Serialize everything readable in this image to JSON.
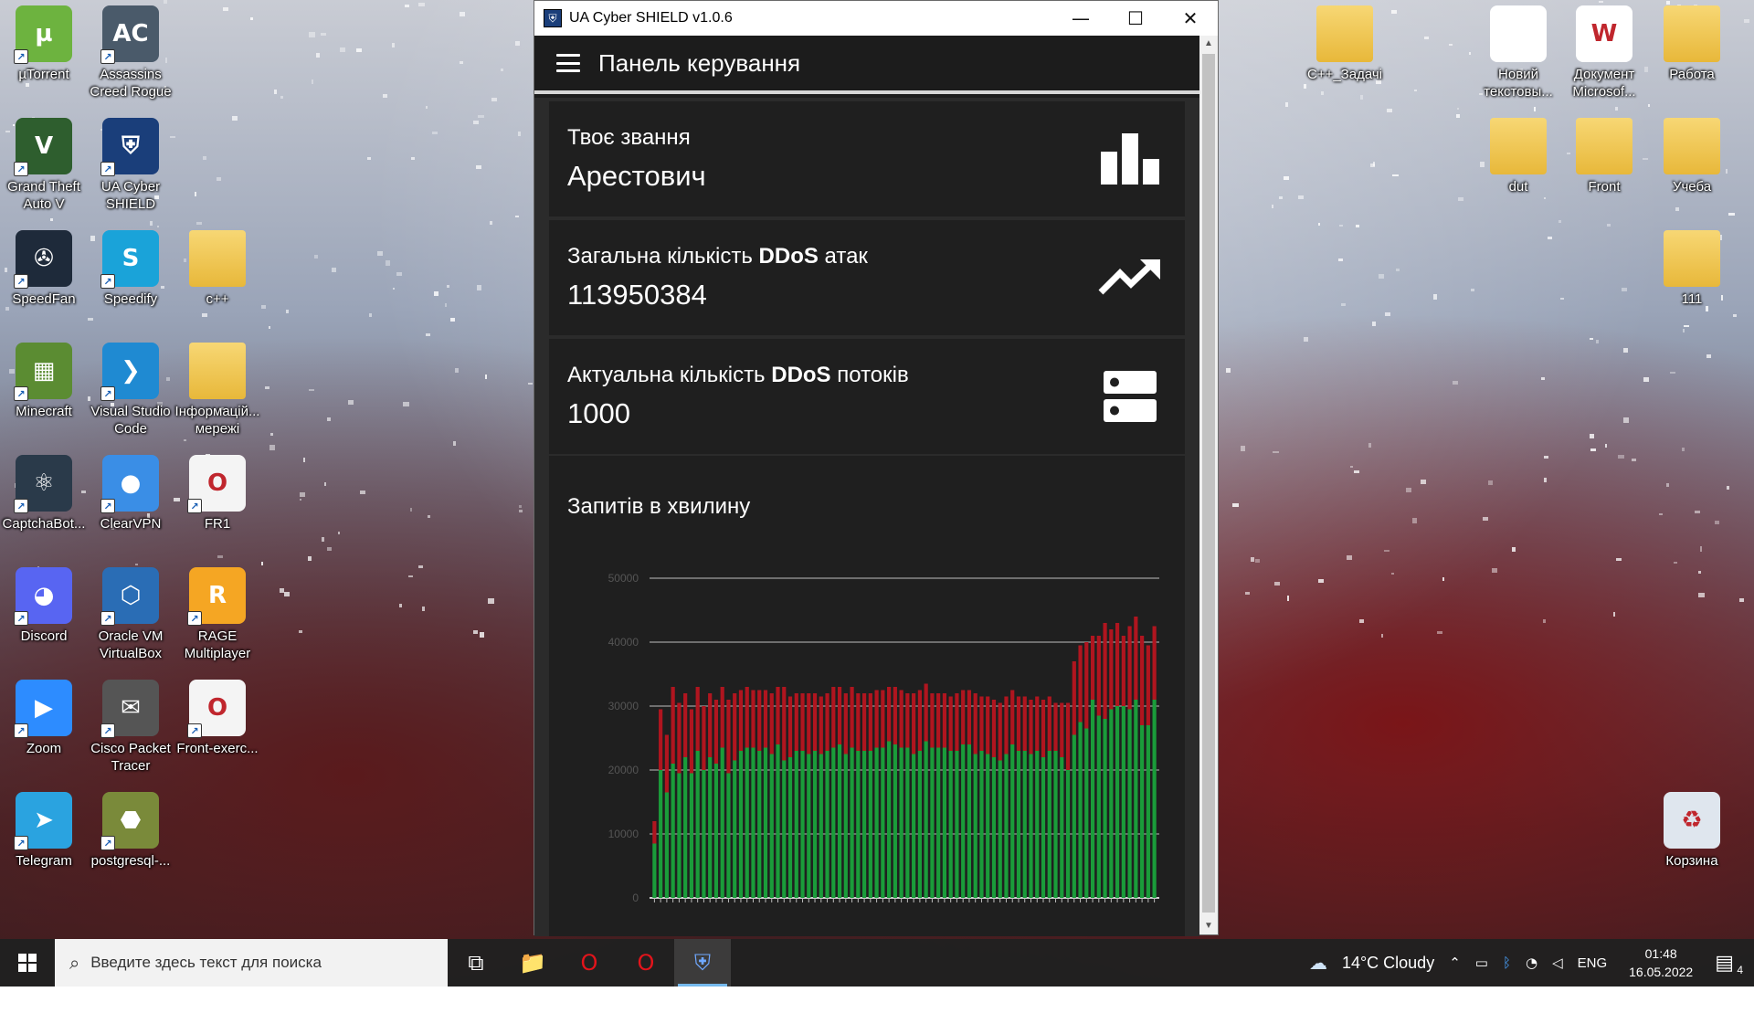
{
  "desktop": {
    "left_icons": [
      {
        "label": "µTorrent",
        "icon": "utorrent-icon",
        "color": "#6db33f",
        "glyph": "µ"
      },
      {
        "label": "Assassins Creed Rogue",
        "icon": "assassins-creed-icon",
        "color": "#4a5a6a",
        "glyph": "AC"
      },
      {
        "label": "Grand Theft Auto V",
        "icon": "gta-icon",
        "color": "#2e5e2e",
        "glyph": "V"
      },
      {
        "label": "UA Cyber SHIELD",
        "icon": "shield-icon",
        "color": "#1a3e7a",
        "glyph": "⛨"
      },
      {
        "label": "SpeedFan",
        "icon": "speedfan-icon",
        "color": "#1e2a3a",
        "glyph": "✇"
      },
      {
        "label": "Speedify",
        "icon": "speedify-icon",
        "color": "#1aa3d9",
        "glyph": "S"
      },
      {
        "label": "c++",
        "icon": "folder-icon",
        "color": "#e8b83a",
        "glyph": ""
      },
      {
        "label": "Minecraft",
        "icon": "minecraft-icon",
        "color": "#5b8c32",
        "glyph": "▦"
      },
      {
        "label": "Visual Studio Code",
        "icon": "vscode-icon",
        "color": "#1f8ad2",
        "glyph": "❯"
      },
      {
        "label": "Інформацій... мережі",
        "icon": "folder-icon",
        "color": "#e8b83a",
        "glyph": ""
      },
      {
        "label": "CaptchaBot...",
        "icon": "captchabot-icon",
        "color": "#2a3a4a",
        "glyph": "⚛"
      },
      {
        "label": "ClearVPN",
        "icon": "clearvpn-icon",
        "color": "#3a8ee6",
        "glyph": "●"
      },
      {
        "label": "FR1",
        "icon": "pdf-icon",
        "color": "#f4f4f4",
        "glyph": "O"
      },
      {
        "label": "Discord",
        "icon": "discord-icon",
        "color": "#5865f2",
        "glyph": "◕"
      },
      {
        "label": "Oracle VM VirtualBox",
        "icon": "virtualbox-icon",
        "color": "#2a6db5",
        "glyph": "⬡"
      },
      {
        "label": "RAGE Multiplayer",
        "icon": "rage-icon",
        "color": "#f5a623",
        "glyph": "R"
      },
      {
        "label": "Zoom",
        "icon": "zoom-icon",
        "color": "#2d8cff",
        "glyph": "▶"
      },
      {
        "label": "Cisco Packet Tracer",
        "icon": "packet-tracer-icon",
        "color": "#555555",
        "glyph": "✉"
      },
      {
        "label": "Front-exerc...",
        "icon": "pdf-icon",
        "color": "#f4f4f4",
        "glyph": "O"
      },
      {
        "label": "Telegram",
        "icon": "telegram-icon",
        "color": "#2aa3e0",
        "glyph": "➤"
      },
      {
        "label": "postgresql-...",
        "icon": "installer-icon",
        "color": "#7a8a3a",
        "glyph": "⬣"
      }
    ],
    "right_icons": [
      {
        "label": "C++_Задачі",
        "icon": "folder-icon",
        "color": "#e8b83a",
        "glyph": ""
      },
      {
        "label": "Новий текстовы...",
        "icon": "text-file-icon",
        "color": "#ffffff",
        "glyph": ""
      },
      {
        "label": "Документ Microsof...",
        "icon": "word-doc-icon",
        "color": "#ffffff",
        "glyph": "W"
      },
      {
        "label": "Работа",
        "icon": "folder-icon",
        "color": "#e8b83a",
        "glyph": ""
      },
      {
        "label": "dut",
        "icon": "folder-icon",
        "color": "#e8b83a",
        "glyph": ""
      },
      {
        "label": "Front",
        "icon": "folder-icon",
        "color": "#e8b83a",
        "glyph": ""
      },
      {
        "label": "Учеба",
        "icon": "folder-icon",
        "color": "#e8b83a",
        "glyph": ""
      },
      {
        "label": "111",
        "icon": "folder-icon",
        "color": "#e8b83a",
        "glyph": ""
      },
      {
        "label": "Корзина",
        "icon": "recycle-bin-icon",
        "color": "#dfe6ee",
        "glyph": "♻"
      }
    ]
  },
  "window": {
    "title": "UA Cyber SHIELD v1.0.6",
    "minimize": "—",
    "maximize": "☐",
    "close": "✕"
  },
  "app": {
    "header_title": "Панель керування",
    "rank": {
      "label": "Твоє звання",
      "value": "Арестович"
    },
    "total_attacks": {
      "label_pre": "Загальна кількість ",
      "label_bold": "DDoS",
      "label_post": " атак",
      "value": "113950384"
    },
    "current_threads": {
      "label_pre": "Актуальна кількість ",
      "label_bold": "DDoS",
      "label_post": " потоків",
      "value": "1000"
    },
    "chart_title": "Запитів в хвилину"
  },
  "chart_data": {
    "type": "bar",
    "stacked": true,
    "ylim": [
      0,
      50000
    ],
    "yticks": [
      0,
      10000,
      20000,
      30000,
      40000,
      50000
    ],
    "grid": true,
    "series": [
      {
        "color": "#1a9c3a",
        "values": [
          8500,
          20000,
          16500,
          21000,
          19500,
          22000,
          19500,
          23000,
          20000,
          22000,
          21000,
          23500,
          19500,
          21500,
          23000,
          23500,
          23500,
          23000,
          23500,
          22500,
          24000,
          21500,
          22000,
          23000,
          23000,
          22500,
          23000,
          22500,
          23000,
          23500,
          24000,
          22500,
          23500,
          23000,
          23000,
          23000,
          23500,
          23500,
          24500,
          24000,
          23500,
          23500,
          22500,
          23000,
          24500,
          23500,
          23500,
          23500,
          23000,
          23000,
          24000,
          24000,
          22500,
          23000,
          22500,
          22000,
          21500,
          22500,
          24000,
          23000,
          23000,
          22500,
          23000,
          22000,
          23000,
          23000,
          22000,
          20000,
          25500,
          27500,
          26500,
          31000,
          28500,
          28000,
          29500,
          30000,
          30000,
          29500,
          31000,
          27000,
          27000,
          31000
        ]
      },
      {
        "color": "#b0151f",
        "values": [
          3500,
          9500,
          9000,
          12000,
          11000,
          10000,
          10000,
          10000,
          10000,
          10000,
          10000,
          9500,
          11500,
          10500,
          9500,
          9500,
          9000,
          9500,
          9000,
          9500,
          9000,
          11500,
          9500,
          9000,
          9000,
          9500,
          9000,
          9000,
          9000,
          9500,
          9000,
          9500,
          9500,
          9000,
          9000,
          9000,
          9000,
          9000,
          8500,
          9000,
          9000,
          8500,
          9500,
          9500,
          9000,
          8500,
          8500,
          8500,
          8500,
          9000,
          8500,
          8500,
          9500,
          8500,
          9000,
          9000,
          9000,
          9000,
          8500,
          8500,
          8500,
          8500,
          8500,
          9000,
          8500,
          7500,
          8500,
          10500,
          11500,
          12000,
          13500,
          10000,
          12500,
          15000,
          12500,
          13000,
          11000,
          13000,
          13000,
          14000,
          12500,
          11500
        ]
      }
    ]
  },
  "taskbar": {
    "search_placeholder": "Введите здесь текст для поиска",
    "apps": [
      {
        "name": "task-view-icon",
        "glyph": "⧉",
        "active": false
      },
      {
        "name": "file-explorer-icon",
        "glyph": "📁",
        "active": false
      },
      {
        "name": "opera-icon",
        "glyph": "O",
        "active": false
      },
      {
        "name": "opera-gx-icon",
        "glyph": "O",
        "active": false
      },
      {
        "name": "ua-cyber-shield-icon",
        "glyph": "⛨",
        "active": true
      }
    ],
    "weather": "14°C  Cloudy",
    "language": "ENG",
    "time": "01:48",
    "date": "16.05.2022",
    "notification_count": "4"
  }
}
